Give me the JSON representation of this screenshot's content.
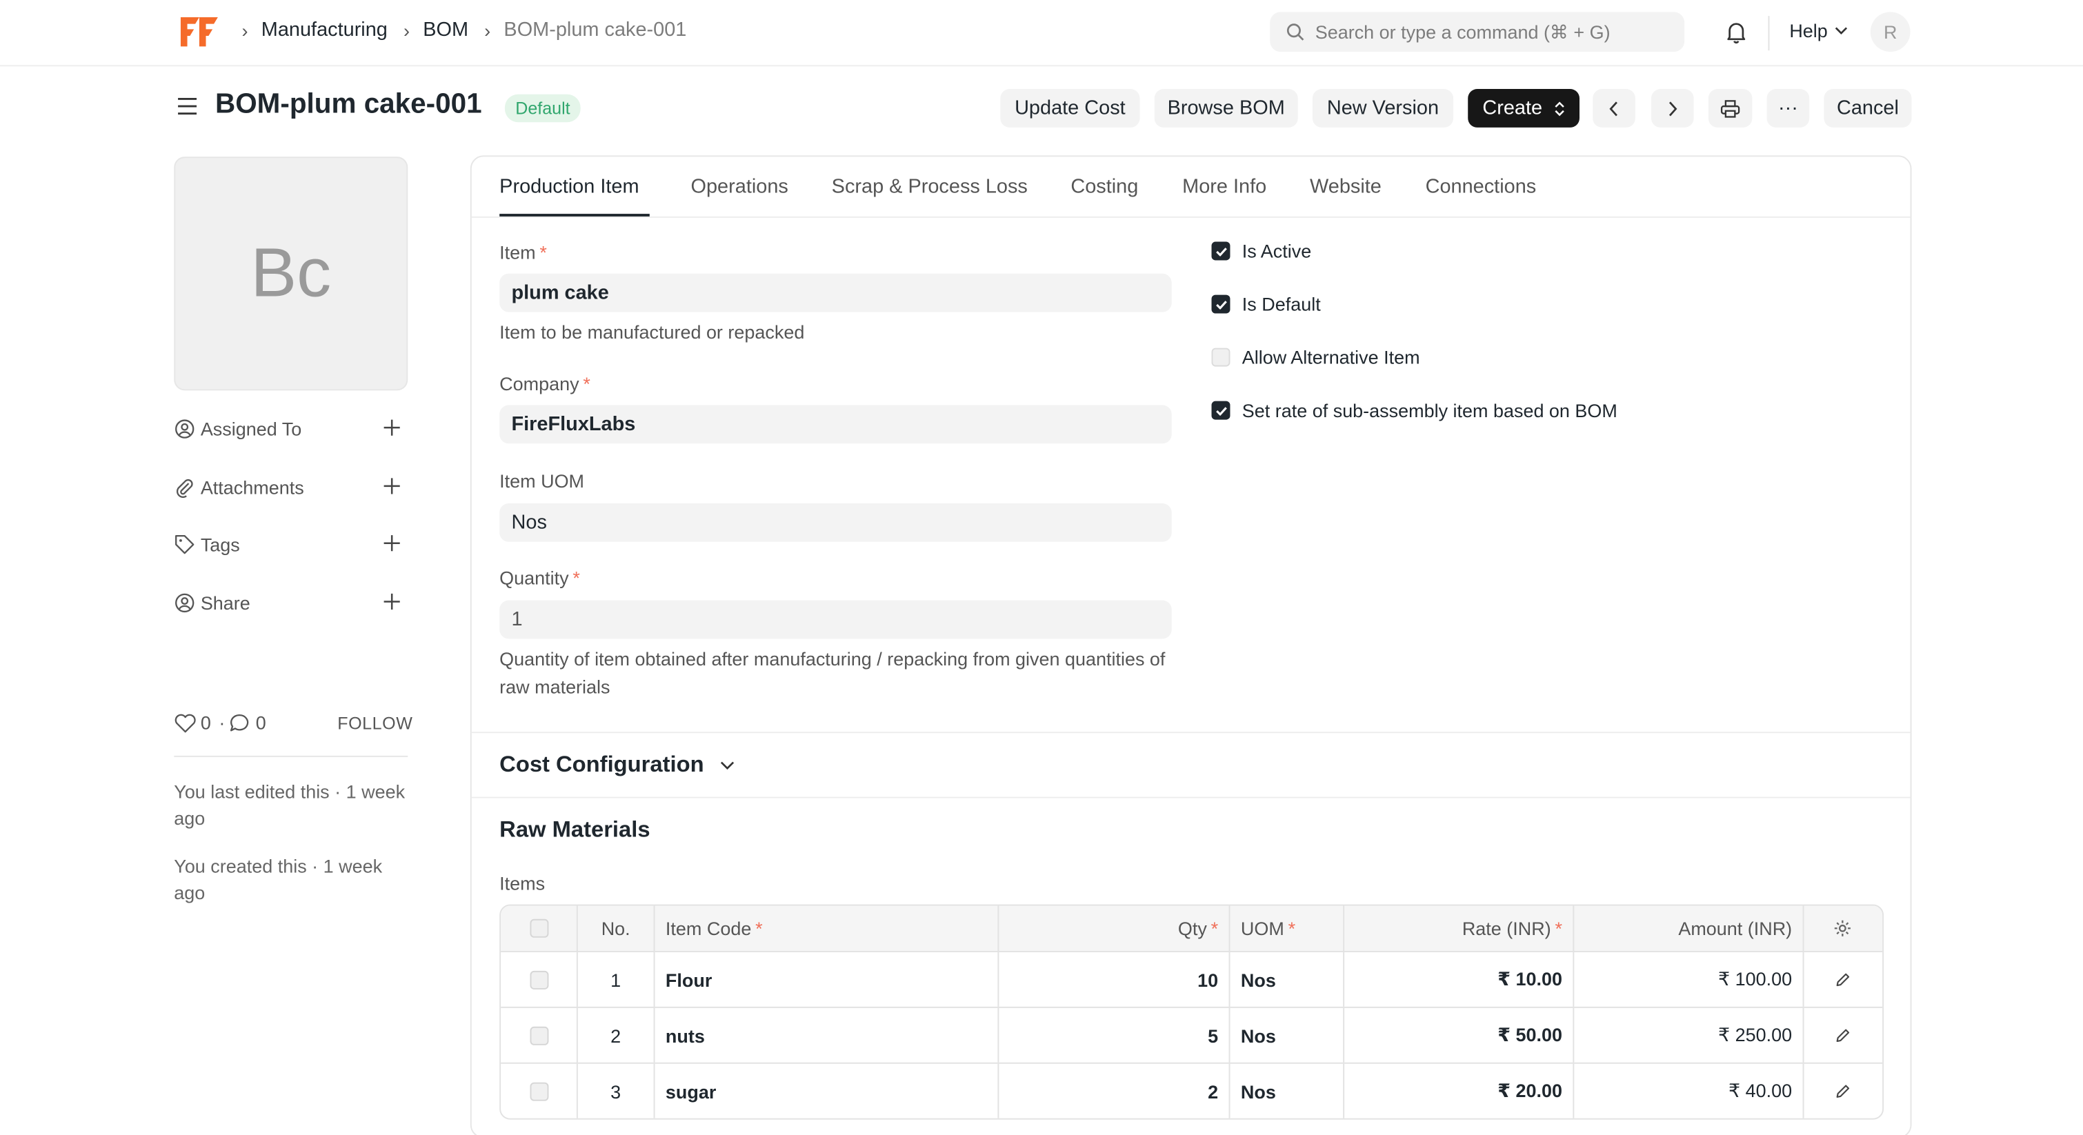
{
  "navbar": {
    "breadcrumbs": [
      "Manufacturing",
      "BOM",
      "BOM-plum cake-001"
    ],
    "search_placeholder": "Search or type a command (⌘ + G)",
    "help_label": "Help",
    "user_initial": "R",
    "brand_color": "#f56b2a"
  },
  "header": {
    "title": "BOM-plum cake-001",
    "status_badge": "Default",
    "buttons": {
      "update_cost": "Update Cost",
      "browse_bom": "Browse BOM",
      "new_version": "New Version",
      "create": "Create",
      "more": "···",
      "cancel": "Cancel"
    }
  },
  "sidebar": {
    "avatar_initials": "Bc",
    "items": [
      {
        "label": "Assigned To",
        "icon": "user-assign-icon"
      },
      {
        "label": "Attachments",
        "icon": "paperclip-icon"
      },
      {
        "label": "Tags",
        "icon": "tag-icon"
      },
      {
        "label": "Share",
        "icon": "share-user-icon"
      }
    ],
    "likes": "0",
    "comments": "0",
    "follow_label": "FOLLOW",
    "last_edited": "You last edited this · 1 week ago",
    "created": "You created this · 1 week ago"
  },
  "tabs": [
    "Production Item",
    "Operations",
    "Scrap & Process Loss",
    "Costing",
    "More Info",
    "Website",
    "Connections"
  ],
  "form": {
    "item_label": "Item",
    "item_value": "plum cake",
    "item_desc": "Item to be manufactured or repacked",
    "company_label": "Company",
    "company_value": "FireFluxLabs",
    "uom_label": "Item UOM",
    "uom_value": "Nos",
    "quantity_label": "Quantity",
    "quantity_value": "1",
    "quantity_desc": "Quantity of item obtained after manufacturing / repacking from given quantities of raw materials",
    "checkboxes": [
      {
        "label": "Is Active",
        "checked": true
      },
      {
        "label": "Is Default",
        "checked": true
      },
      {
        "label": "Allow Alternative Item",
        "checked": false
      },
      {
        "label": "Set rate of sub-assembly item based on BOM",
        "checked": true
      }
    ]
  },
  "sections": {
    "cost_configuration": "Cost Configuration",
    "raw_materials": "Raw Materials",
    "items_label": "Items"
  },
  "table": {
    "headers": {
      "no": "No.",
      "item_code": "Item Code",
      "qty": "Qty",
      "uom": "UOM",
      "rate": "Rate (INR)",
      "amount": "Amount (INR)"
    },
    "rows": [
      {
        "no": "1",
        "item_code": "Flour",
        "qty": "10",
        "uom": "Nos",
        "rate": "₹ 10.00",
        "amount": "₹ 100.00"
      },
      {
        "no": "2",
        "item_code": "nuts",
        "qty": "5",
        "uom": "Nos",
        "rate": "₹ 50.00",
        "amount": "₹ 250.00"
      },
      {
        "no": "3",
        "item_code": "sugar",
        "qty": "2",
        "uom": "Nos",
        "rate": "₹ 20.00",
        "amount": "₹ 40.00"
      }
    ]
  }
}
